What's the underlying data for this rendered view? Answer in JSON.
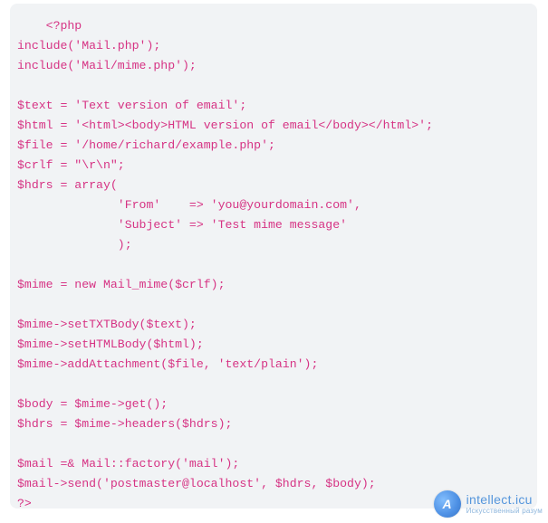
{
  "code": {
    "lines": [
      "    <?php",
      "include('Mail.php');",
      "include('Mail/mime.php');",
      "",
      "$text = 'Text version of email';",
      "$html = '<html><body>HTML version of email</body></html>';",
      "$file = '/home/richard/example.php';",
      "$crlf = \"\\r\\n\";",
      "$hdrs = array(",
      "              'From'    => 'you@yourdomain.com',",
      "              'Subject' => 'Test mime message'",
      "              );",
      "",
      "$mime = new Mail_mime($crlf);",
      "",
      "$mime->setTXTBody($text);",
      "$mime->setHTMLBody($html);",
      "$mime->addAttachment($file, 'text/plain');",
      "",
      "$body = $mime->get();",
      "$hdrs = $mime->headers($hdrs);",
      "",
      "$mail =& Mail::factory('mail');",
      "$mail->send('postmaster@localhost', $hdrs, $body);",
      "?>"
    ]
  },
  "watermark": {
    "logo_letter": "A",
    "main": "intellect.icu",
    "sub": "Искусственный разум"
  }
}
